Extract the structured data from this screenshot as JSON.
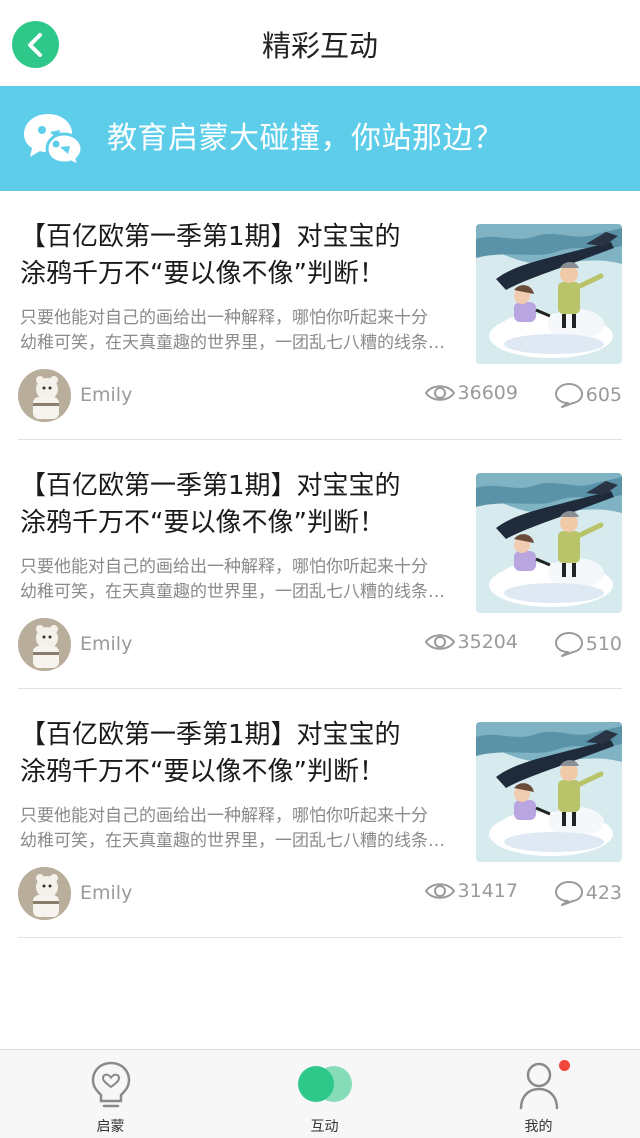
{
  "header": {
    "title": "精彩互动",
    "back_icon": "chevron-left-icon"
  },
  "banner": {
    "text": "教育启蒙大碰撞，你站那边？",
    "icon": "chat-bubbles-icon",
    "background": "#5ecdea"
  },
  "posts": [
    {
      "title_line1": "【百亿欧第一季第1期】对宝宝的",
      "title_line2": "涂鸦千万不“要以像不像”判断！",
      "desc_line1": "只要他能对自己的画给出一种解释，哪怕你听起来十分",
      "desc_line2": "幼稚可笑，在天真童趣的世界里，一团乱七八糟的线条…",
      "author": "Emily",
      "views": "36609",
      "comments": "605"
    },
    {
      "title_line1": "【百亿欧第一季第1期】对宝宝的",
      "title_line2": "涂鸦千万不“要以像不像”判断！",
      "desc_line1": "只要他能对自己的画给出一种解释，哪怕你听起来十分",
      "desc_line2": "幼稚可笑，在天真童趣的世界里，一团乱七八糟的线条…",
      "author": "Emily",
      "views": "35204",
      "comments": "510"
    },
    {
      "title_line1": "【百亿欧第一季第1期】对宝宝的",
      "title_line2": "涂鸦千万不“要以像不像”判断！",
      "desc_line1": "只要他能对自己的画给出一种解释，哪怕你听起来十分",
      "desc_line2": "幼稚可笑，在天真童趣的世界里，一团乱七八糟的线条…",
      "author": "Emily",
      "views": "31417",
      "comments": "423"
    }
  ],
  "tabbar": {
    "tabs": [
      {
        "label": "启蒙",
        "icon": "lightbulb-heart-icon",
        "active": false
      },
      {
        "label": "互动",
        "icon": "two-circles-icon",
        "active": true
      },
      {
        "label": "我的",
        "icon": "user-icon",
        "active": false,
        "badge": true
      }
    ]
  },
  "colors": {
    "accent": "#2ec98a",
    "banner": "#5ecdea",
    "badge": "#f2463b"
  }
}
